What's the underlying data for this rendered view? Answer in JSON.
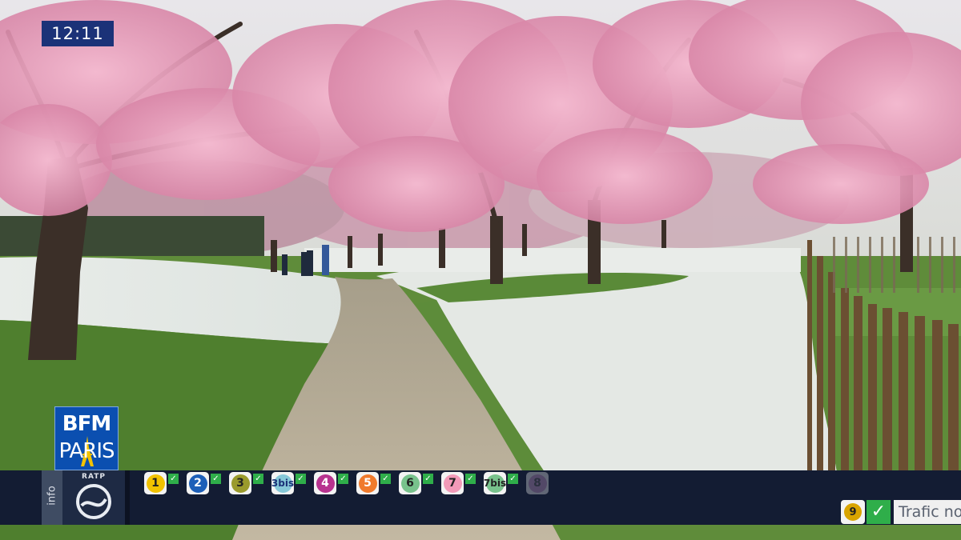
{
  "clock": {
    "time": "12:11"
  },
  "channel": {
    "logo_line1": "BFM",
    "logo_line2": "PARIS"
  },
  "ticker": {
    "info_label": "info",
    "operator_label": "RATP",
    "lines": [
      {
        "num": "1",
        "color": "#f2c200",
        "text_color": "#222222",
        "status": "ok"
      },
      {
        "num": "2",
        "color": "#1d5fb8",
        "text_color": "#ffffff",
        "status": "ok"
      },
      {
        "num": "3",
        "color": "#9a9a2c",
        "text_color": "#222222",
        "status": "ok"
      },
      {
        "num": "3bis",
        "color": "#86c8d8",
        "text_color": "#1b3278",
        "status": "ok"
      },
      {
        "num": "4",
        "color": "#b8338f",
        "text_color": "#ffffff",
        "status": "ok"
      },
      {
        "num": "5",
        "color": "#f07a2c",
        "text_color": "#ffffff",
        "status": "ok"
      },
      {
        "num": "6",
        "color": "#78c28c",
        "text_color": "#222222",
        "status": "ok"
      },
      {
        "num": "7",
        "color": "#f29ab8",
        "text_color": "#222222",
        "status": "ok"
      },
      {
        "num": "7bis",
        "color": "#78c28c",
        "text_color": "#222222",
        "status": "ok"
      },
      {
        "num": "8",
        "color": "#c89ac8",
        "text_color": "#555555",
        "status": "fading"
      }
    ],
    "traffic": {
      "line": "9",
      "text": "Trafic no"
    }
  }
}
